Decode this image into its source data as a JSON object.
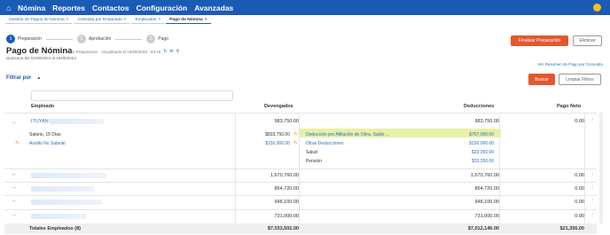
{
  "nav": {
    "items": [
      "Nómina",
      "Reportes",
      "Contactos",
      "Configuración",
      "Avanzadas"
    ],
    "avatar_letter": "E"
  },
  "tabs": [
    {
      "label": "Gestión de Pagos de Nómina"
    },
    {
      "label": "Consulta por Empleado"
    },
    {
      "label": "Empleados"
    },
    {
      "label": "Pago de Nómina"
    }
  ],
  "steps": [
    {
      "num": "1",
      "label": "Preparación"
    },
    {
      "num": "2",
      "label": "Aprobación"
    },
    {
      "num": "3",
      "label": "Pago"
    }
  ],
  "header": {
    "title": "Pago de Nómina",
    "status": "En Preparación",
    "updated": "Actualizado el 13/09/2024 - 03:16",
    "period": "Quincena del 01/09/2024 al 15/09/2024",
    "finalize_label": "Finalizar Preparación",
    "delete_label": "Eliminar",
    "summary_link": "Ver Resumen de Pago por Concepto"
  },
  "filter": {
    "label": "Filtrar por",
    "search_label": "Buscar",
    "clear_label": "Limpiar Filtros",
    "search_placeholder": ""
  },
  "table": {
    "columns": [
      "Empleado",
      "Devengados",
      "Deducciones",
      "Pago Neto"
    ],
    "rows": [
      {
        "name": "ITUYAN",
        "dev": "983,750.00",
        "ded": "983,750.00",
        "neto": "0.00"
      },
      {
        "name": "",
        "dev": "1,670,760.00",
        "ded": "1,670,760.00",
        "neto": "0.00"
      },
      {
        "name": "",
        "dev": "854,720.00",
        "ded": "854,720.00",
        "neto": "0.00"
      },
      {
        "name": "",
        "dev": "948,100.00",
        "ded": "948,100.00",
        "neto": "0.00"
      },
      {
        "name": "",
        "dev": "731,000.00",
        "ded": "731,000.00",
        "neto": "0.00"
      }
    ],
    "detail": {
      "salary_label": "Salario, 15 Días",
      "salary_value": "$833,750.00",
      "aux_label": "Auxilio No Salarial",
      "aux_value": "$150,000.00",
      "ded1_label": "Deducción por Afiliación de Obra, Saldo ...",
      "ded1_value": "$767,050.00",
      "ded2_label": "Otras Deducciones",
      "ded2_value": "$150,000.00",
      "ded3_label": "Salud",
      "ded3_value": "$33,350.00",
      "ded4_label": "Pensión",
      "ded4_value": "$33,350.00"
    },
    "totals": {
      "label": "Totales Empleados (8)",
      "dev": "$7,033,502.00",
      "ded": "$7,012,146.00",
      "neto": "$21,356.00"
    }
  },
  "colors": {
    "brand": "#1a5bb5",
    "accent": "#e4572e",
    "highlight": "#e7f0a8"
  }
}
